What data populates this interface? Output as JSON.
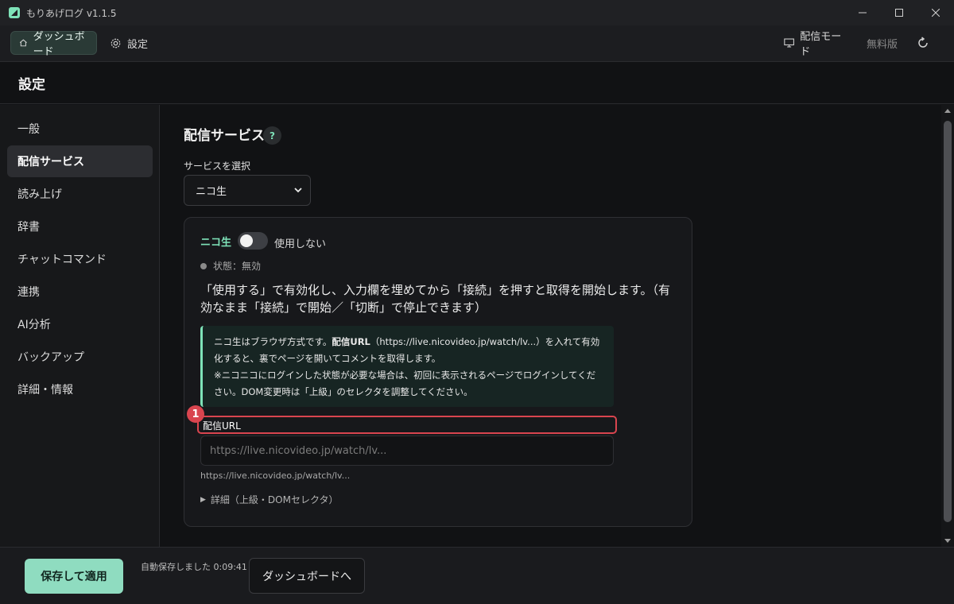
{
  "window": {
    "title": "もりあげログ  v1.1.5"
  },
  "topnav": {
    "dashboard": "ダッシュボード",
    "settings": "設定",
    "stream_mode": "配信モード",
    "plan": "無料版"
  },
  "page": {
    "title": "設定"
  },
  "sidebar": {
    "items": [
      {
        "label": "一般"
      },
      {
        "label": "配信サービス"
      },
      {
        "label": "読み上げ"
      },
      {
        "label": "辞書"
      },
      {
        "label": "チャットコマンド"
      },
      {
        "label": "連携"
      },
      {
        "label": "AI分析"
      },
      {
        "label": "バックアップ"
      },
      {
        "label": "詳細・情報"
      }
    ],
    "active_index": 1
  },
  "section": {
    "title": "配信サービス",
    "help": "?",
    "select_label": "サービスを選択",
    "select_value": "ニコ生"
  },
  "card": {
    "service_name": "ニコ生",
    "toggle_label": "使用しない",
    "toggle_on": false,
    "status": "状態：無効",
    "description": "「使用する」で有効化し、入力欄を埋めてから「接続」を押すと取得を開始します。（有効なまま「接続」で開始／「切断」で停止できます）",
    "info_line1_pre": "ニコ生はブラウザ方式です。",
    "info_line1_bold": "配信URL",
    "info_line1_post": "（https://live.nicovideo.jp/watch/lv...）を入れて有効化すると、裏でページを開いてコメントを取得します。",
    "info_line2": "※ニコニコにログインした状態が必要な場合は、初回に表示されるページでログインしてください。DOM変更時は「上級」のセレクタを調整してください。",
    "url_label": "配信URL",
    "url_badge": "1",
    "url_value": "",
    "url_placeholder": "https://live.nicovideo.jp/watch/lv...",
    "url_hint": "https://live.nicovideo.jp/watch/lv...",
    "details_label": "詳細（上級・DOMセレクタ）"
  },
  "footer": {
    "save": "保存して適用",
    "autosave": "自動保存しました 0:09:41",
    "dashboard": "ダッシュボードへ"
  },
  "colors": {
    "accent": "#7ee2b8",
    "highlight": "#d9454f",
    "background": "#111214"
  }
}
